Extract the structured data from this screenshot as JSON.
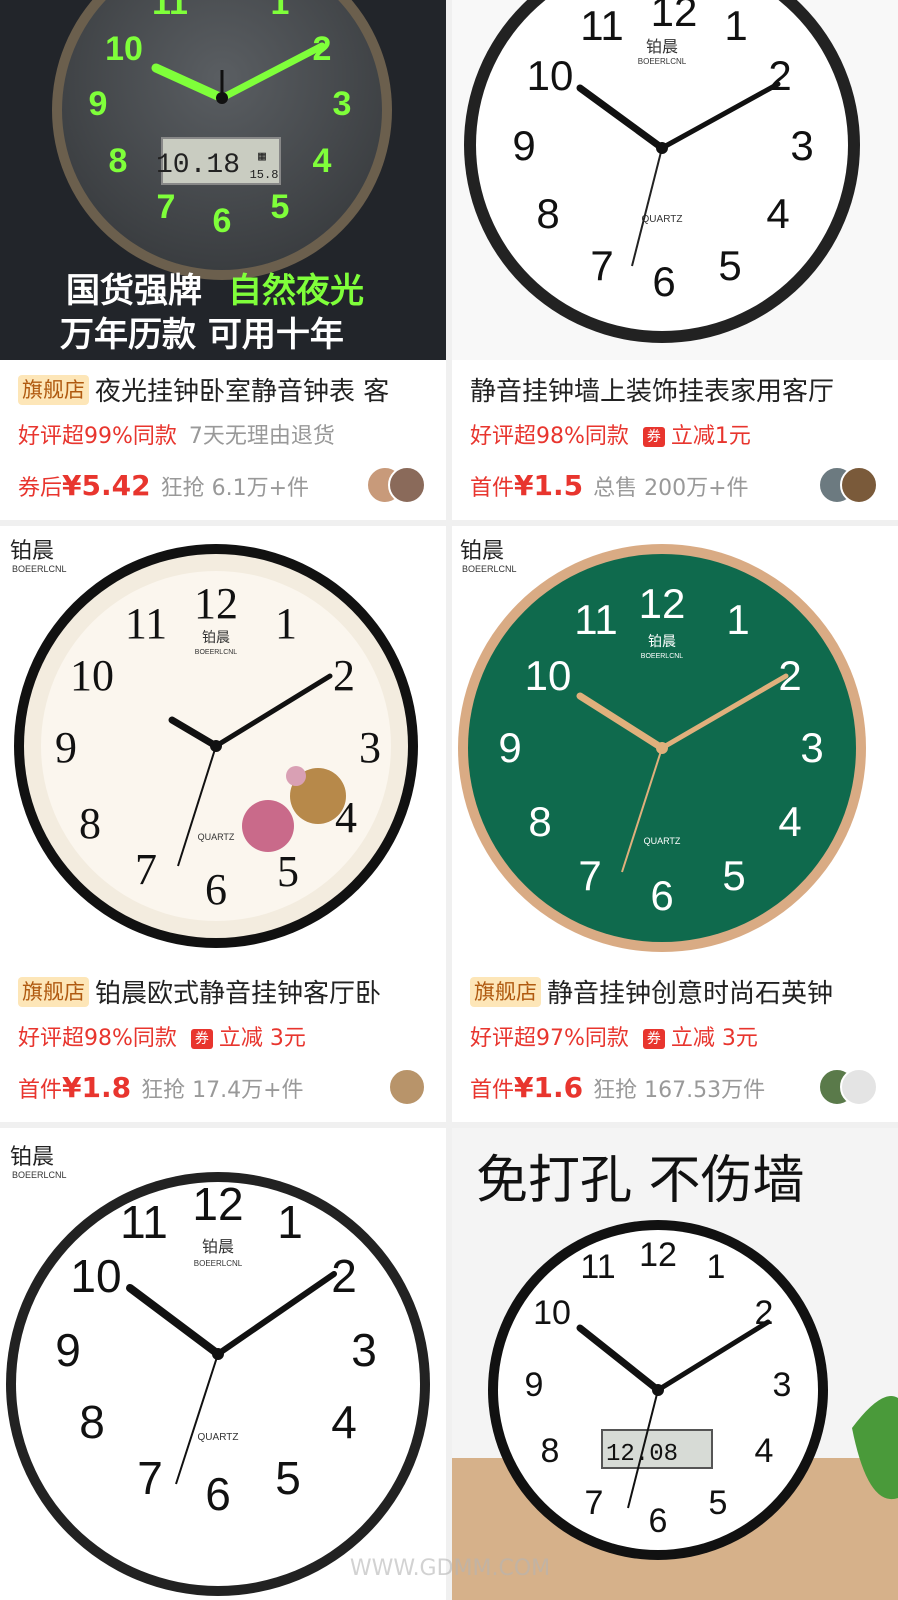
{
  "products": [
    {
      "title": "夜光挂钟卧室静音钟表 客",
      "flag": "旗舰店",
      "rating_tag": "好评超99%同款",
      "extra_tag": "7天无理由退货",
      "coupon_icon": "",
      "price_label": "券后",
      "price": "¥5.42",
      "sales": "狂抢 6.1万+件",
      "image_text": [
        "国货强牌",
        "自然夜光",
        "万年历款 可用十年"
      ],
      "lcd_text": "10.18"
    },
    {
      "title": "静音挂钟墙上装饰挂表家用客厅",
      "flag": "",
      "rating_tag": "好评超98%同款",
      "coupon_icon": "券",
      "extra_tag": "立减1元",
      "price_label": "首件",
      "price": "¥1.5",
      "sales": "总售 200万+件",
      "brand": "铂晨",
      "brand_en": "BOEERLCNL",
      "dial_label": "QUARTZ"
    },
    {
      "title": "铂晨欧式静音挂钟客厅卧",
      "flag": "旗舰店",
      "rating_tag": "好评超98%同款",
      "coupon_icon": "券",
      "extra_tag": "立减 3元",
      "price_label": "首件",
      "price": "¥1.8",
      "sales": "狂抢 17.4万+件",
      "brand": "铂晨",
      "brand_en": "BOEERLCNL",
      "dial_label": "QUARTZ"
    },
    {
      "title": "静音挂钟创意时尚石英钟",
      "flag": "旗舰店",
      "rating_tag": "好评超97%同款",
      "coupon_icon": "券",
      "extra_tag": "立减 3元",
      "price_label": "首件",
      "price": "¥1.6",
      "sales": "狂抢 167.53万件",
      "brand": "铂晨",
      "brand_en": "BOEERLCNL",
      "dial_label": "QUARTZ"
    },
    {
      "brand": "铂晨",
      "brand_en": "BOEERLCNL",
      "dial_label": "QUARTZ"
    },
    {
      "image_text": "免打孔 不伤墙",
      "lcd_text": "12.08"
    }
  ],
  "watermark": "WWW.GDMM.COM",
  "colors": {
    "price_red": "#e8352e",
    "flag_bg": "#fde6b8",
    "green_dial": "#0f6a4d",
    "glow_green": "#7fff3a"
  }
}
